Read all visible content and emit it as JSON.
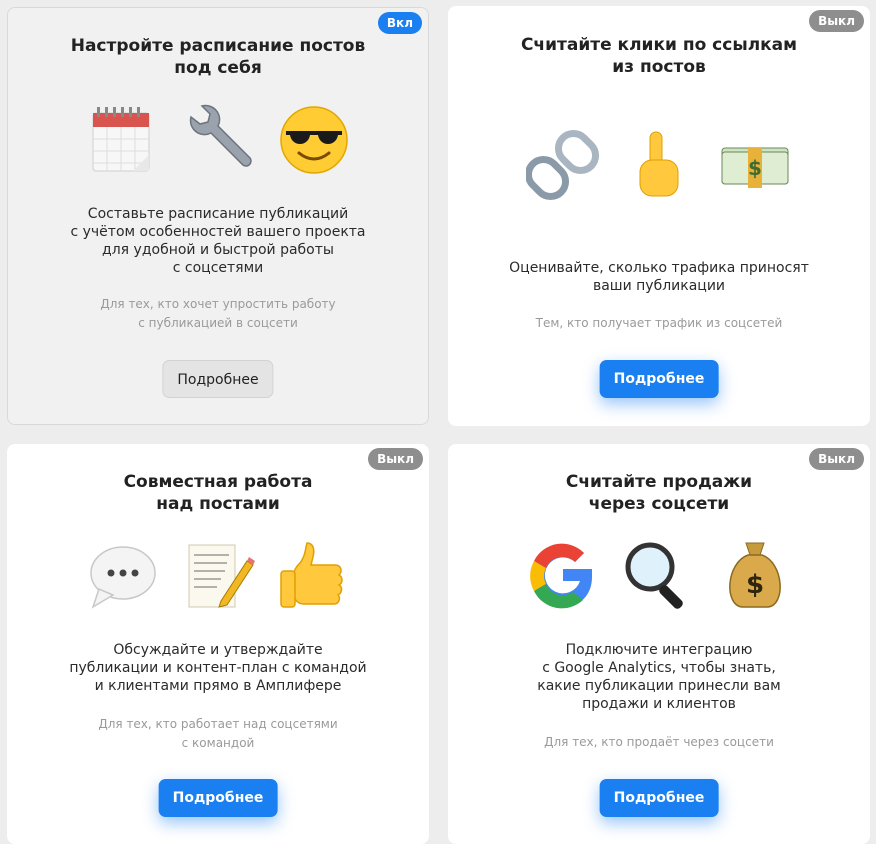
{
  "cards": [
    {
      "title": "Настройте расписание постов\nпод себя",
      "badge": "Вкл",
      "icons": [
        "calendar-icon",
        "wrench-icon",
        "sunglasses-smiley-icon"
      ],
      "description": "Составьте расписание публикаций\nс учётом особенностей вашего проекта\nдля удобной и быстрой работы\nс соцсетями",
      "audience": "Для тех, кто хочет упростить работу\nс публикацией в соцсети",
      "button": "Подробнее"
    },
    {
      "title": "Считайте клики по ссылкам\nиз постов",
      "badge": "Выкл",
      "icons": [
        "chain-link-icon",
        "pointing-finger-icon",
        "money-stack-icon"
      ],
      "description": "Оценивайте, сколько трафика приносят\nваши публикации",
      "audience": "Тем, кто получает трафик из соцсетей",
      "button": "Подробнее"
    },
    {
      "title": "Совместная работа\nнад постами",
      "badge": "Выкл",
      "icons": [
        "speech-bubble-icon",
        "memo-pencil-icon",
        "thumbs-up-icon"
      ],
      "description": "Обсуждайте и утверждайте\nпубликации и контент-план с командой\nи клиентами прямо в Амплифере",
      "audience": "Для тех, кто работает над соцсетями\nс командой",
      "button": "Подробнее"
    },
    {
      "title": "Считайте продажи\nчерез соцсети",
      "badge": "Выкл",
      "icons": [
        "google-logo-icon",
        "magnifier-icon",
        "money-bag-icon"
      ],
      "description": "Подключите интеграцию\nс Google Analytics, чтобы знать,\nкакие публикации принесли вам\nпродажи и клиентов",
      "audience": "Для тех, кто продаёт через соцсети",
      "button": "Подробнее"
    }
  ],
  "colors": {
    "accent": "#1a7ff0",
    "badge_off": "#8e8e8e",
    "active_card_bg": "#f1f1f1"
  }
}
